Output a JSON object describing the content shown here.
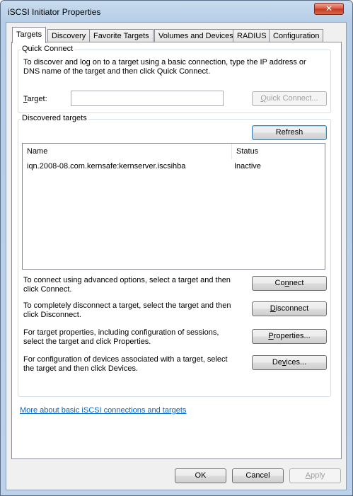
{
  "window": {
    "title": "iSCSI Initiator Properties",
    "close_glyph": "✕"
  },
  "tabs": [
    {
      "label": "Targets",
      "active": true
    },
    {
      "label": "Discovery",
      "active": false
    },
    {
      "label": "Favorite Targets",
      "active": false
    },
    {
      "label": "Volumes and Devices",
      "active": false
    },
    {
      "label": "RADIUS",
      "active": false
    },
    {
      "label": "Configuration",
      "active": false
    }
  ],
  "quick_connect": {
    "group_label": "Quick Connect",
    "description": "To discover and log on to a target using a basic connection, type the IP address or DNS name of the target and then click Quick Connect.",
    "target_label": "Target:",
    "target_value": "",
    "button": "Quick Connect..."
  },
  "discovered": {
    "group_label": "Discovered targets",
    "refresh_button": "Refresh",
    "columns": [
      "Name",
      "Status"
    ],
    "rows": [
      {
        "name": "iqn.2008-08.com.kernsafe:kernserver.iscsihba",
        "status": "Inactive"
      }
    ],
    "connect_text": "To connect using advanced options, select a target and then click Connect.",
    "connect_button": "Connect",
    "disconnect_text": "To completely disconnect a target, select the target and then click Disconnect.",
    "disconnect_button": "Disconnect",
    "properties_text": "For target properties, including configuration of sessions, select the target and click Properties.",
    "properties_button": "Properties...",
    "devices_text": "For configuration of devices associated with a target, select the target and then click Devices.",
    "devices_button": "Devices..."
  },
  "link": "More about basic iSCSI connections and targets",
  "footer": {
    "ok": "OK",
    "cancel": "Cancel",
    "apply": "Apply"
  }
}
